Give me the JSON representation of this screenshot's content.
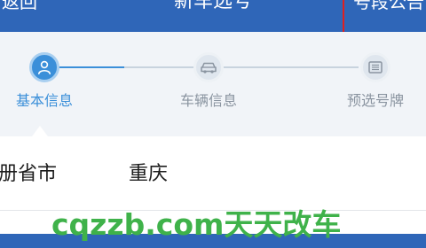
{
  "header": {
    "back_label": "返回",
    "title": "新车选号",
    "right_action": "号段公告",
    "background_color": "#2f66b8"
  },
  "steps": [
    {
      "label": "基本信息",
      "icon": "user-icon",
      "state": "active"
    },
    {
      "label": "车辆信息",
      "icon": "car-icon",
      "state": "inactive"
    },
    {
      "label": "预选号牌",
      "icon": "plate-icon",
      "state": "inactive"
    }
  ],
  "form": {
    "field_label": "册省市",
    "field_value": "重庆"
  },
  "watermark": {
    "text": "cqzzb.com天天改车",
    "color": "#3fb24a"
  },
  "colors": {
    "accent": "#3b8fd9",
    "highlight": "#e02020",
    "inactive": "#8a94a0"
  }
}
